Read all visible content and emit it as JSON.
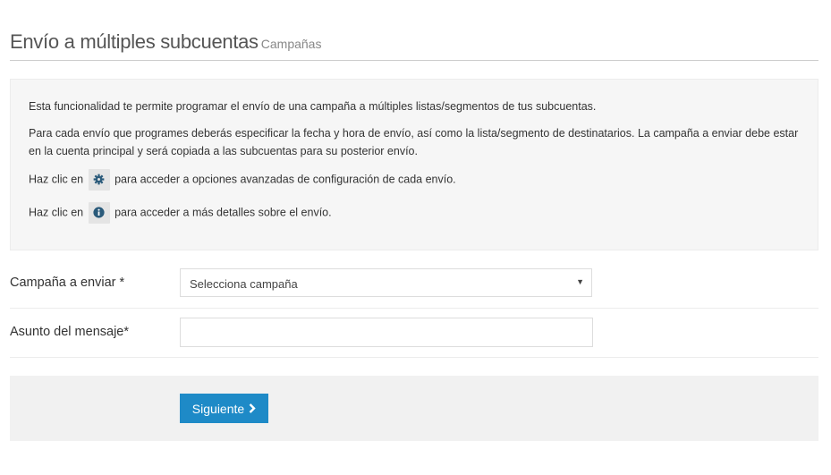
{
  "header": {
    "title": "Envío a múltiples subcuentas",
    "subtitle": "Campañas"
  },
  "info": {
    "p1": "Esta funcionalidad te permite programar el envío de una campaña a múltiples listas/segmentos de tus subcuentas.",
    "p2": "Para cada envío que programes deberás especificar la fecha y hora de envío, así como la lista/segmento de destinatarios. La campaña a enviar debe estar en la cuenta principal y será copiada a las subcuentas para su posterior envío.",
    "p3_before": "Haz clic en",
    "p3_after": "para acceder a opciones avanzadas de configuración de cada envío.",
    "p3_icon": "gear-icon",
    "p4_before": "Haz clic en",
    "p4_after": "para acceder a más detalles sobre el envío.",
    "p4_icon": "info-icon"
  },
  "form": {
    "campaign_label": "Campaña a enviar *",
    "campaign_selected": "Selecciona campaña",
    "subject_label": "Asunto del mensaje*",
    "subject_value": ""
  },
  "footer": {
    "next_label": "Siguiente",
    "next_icon": "chevron-right-icon"
  },
  "colors": {
    "accent": "#1e8ac7",
    "info_bg": "#f6f6f6",
    "footer_bg": "#f1f1f1",
    "icon_color": "#2a5a7a"
  }
}
